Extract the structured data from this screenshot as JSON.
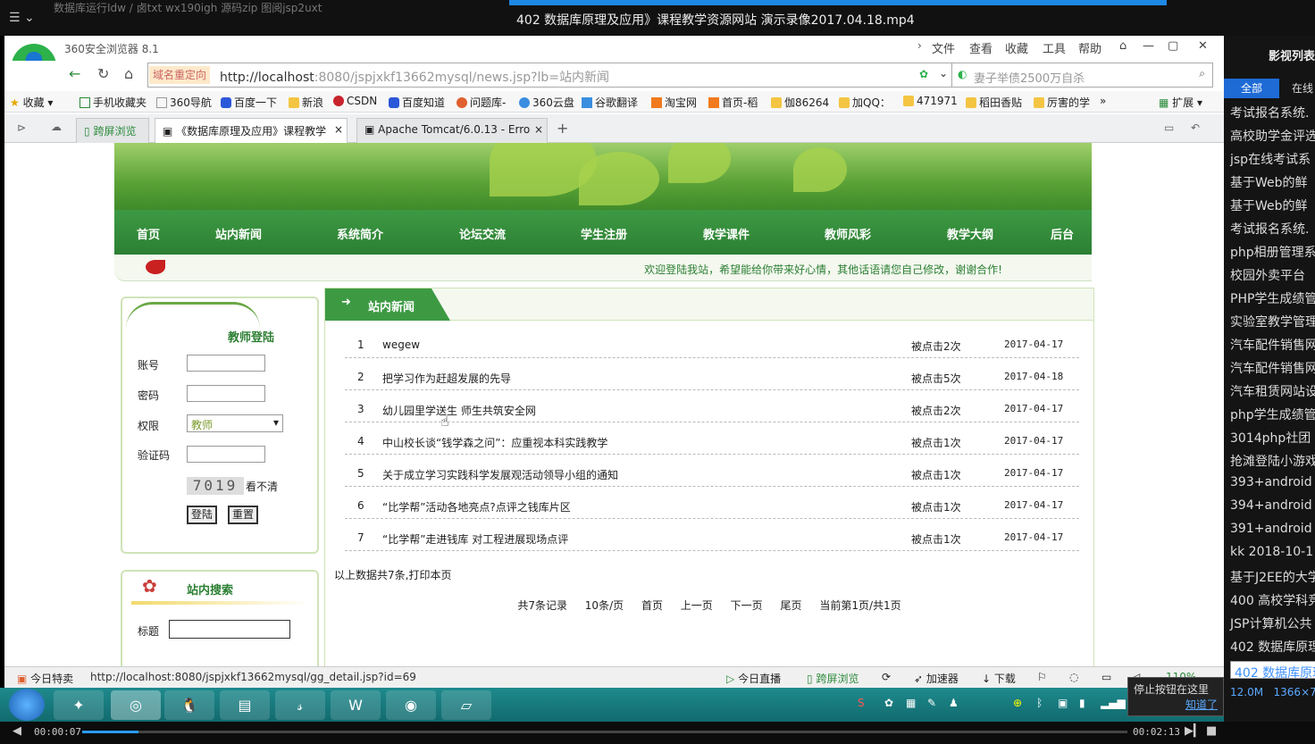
{
  "player": {
    "title": "402 数据库原理及应用》课程教学资源网站 演示录像2017.04.18.mp4",
    "top_bg_text": "数据库运行Idw  /  卤txt  wx190igh  源码zip  图阅jsp2uxt",
    "current_time": "00:00:07",
    "total_time": "00:02:13",
    "progress": 0.054
  },
  "browser": {
    "app_name": "360安全浏览器 8.1",
    "menu": [
      "文件",
      "查看",
      "收藏",
      "工具",
      "帮助"
    ],
    "url_redirect": "域名重定向",
    "url_host": "http://localhost",
    "url_rest": ":8080/jspjxkf13662mysql/news.jsp?lb=站内新闻",
    "search_placeholder": "妻子举债2500万自杀",
    "favorites_label": "收藏",
    "favorites": [
      "手机收藏夹",
      "360导航",
      "百度一下",
      "新浪",
      "CSDN",
      "百度知道",
      "问题库-",
      "360云盘",
      "谷歌翻译",
      "淘宝网",
      "首页-稻",
      "伽86264",
      "加QQ：",
      "471971",
      "稻田香贴",
      "厉害的学"
    ],
    "extend_label": "扩展",
    "tabs": [
      {
        "label": "跨屏浏览"
      },
      {
        "label": "《数据库原理及应用》课程教学"
      },
      {
        "label": "Apache Tomcat/6.0.13 - Erro"
      }
    ],
    "status_url": "http://localhost:8080/jspjxkf13662mysql/gg_detail.jsp?id=69",
    "status_items": [
      "今日特卖",
      "今日直播",
      "跨屏浏览",
      "加速器",
      "下载"
    ],
    "zoom": "110%"
  },
  "site": {
    "nav": [
      "首页",
      "站内新闻",
      "系统简介",
      "论坛交流",
      "学生注册",
      "教学课件",
      "教师风彩",
      "教学大纲",
      "后台"
    ],
    "welcome": "欢迎登陆我站，希望能给你带来好心情，其他话语请您自己修改，谢谢合作!",
    "login": {
      "title": "教师登陆",
      "account_label": "账号",
      "password_label": "密码",
      "role_label": "权限",
      "role_value": "教师",
      "captcha_label": "验证码",
      "captcha_text": "7019",
      "captcha_refresh": "看不清",
      "login_button": "登陆",
      "reset_button": "重置"
    },
    "search": {
      "title": "站内搜索",
      "title_label": "标题"
    },
    "news": {
      "header": "站内新闻",
      "arrow": "➜",
      "rows": [
        {
          "idx": "1",
          "title": "wegew",
          "clicks": "被点击2次",
          "date": "2017-04-17"
        },
        {
          "idx": "2",
          "title": "把学习作为赶超发展的先导",
          "clicks": "被点击5次",
          "date": "2017-04-18"
        },
        {
          "idx": "3",
          "title": "幼儿园里学送生 师生共筑安全网",
          "clicks": "被点击2次",
          "date": "2017-04-17"
        },
        {
          "idx": "4",
          "title": "中山校长谈“钱学森之问”：应重视本科实践教学",
          "clicks": "被点击1次",
          "date": "2017-04-17"
        },
        {
          "idx": "5",
          "title": "关于成立学习实践科学发展观活动领导小组的通知",
          "clicks": "被点击1次",
          "date": "2017-04-17"
        },
        {
          "idx": "6",
          "title": "“比学帮”活动各地亮点?点评之钱库片区",
          "clicks": "被点击1次",
          "date": "2017-04-17"
        },
        {
          "idx": "7",
          "title": "“比学帮”走进钱库 对工程进展现场点评",
          "clicks": "被点击1次",
          "date": "2017-04-17"
        }
      ],
      "summary": "以上数据共7条,打印本页",
      "pager": [
        "共7条记录",
        "10条/页",
        "首页",
        "上一页",
        "下一页",
        "尾页",
        "当前第1页/共1页"
      ]
    }
  },
  "side_panel": {
    "header": "影视列表",
    "tab_all": "全部",
    "tab_online": "在线",
    "items": [
      "考试报名系统.",
      "高校助学金评选",
      "jsp在线考试系",
      "基于Web的鲜",
      "基于Web的鲜",
      "考试报名系统.",
      "php相册管理系",
      "校园外卖平台",
      "PHP学生成绩管",
      "实验室教学管理",
      "汽车配件销售网",
      "汽车配件销售网",
      "汽车租赁网站设",
      "php学生成绩管",
      "3014php社团",
      "抢滩登陆小游戏",
      "393+android",
      "394+android",
      "391+android",
      "kk 2018-10-1",
      "基于J2EE的大学",
      "400 高校学科竞",
      "JSP计算机公共",
      "402 数据库原理",
      "402 数据库原理"
    ],
    "meta_size": "12.0M",
    "meta_res": "1366×7"
  },
  "tooltip": {
    "text": "停止按钮在这里",
    "link": "知道了"
  }
}
